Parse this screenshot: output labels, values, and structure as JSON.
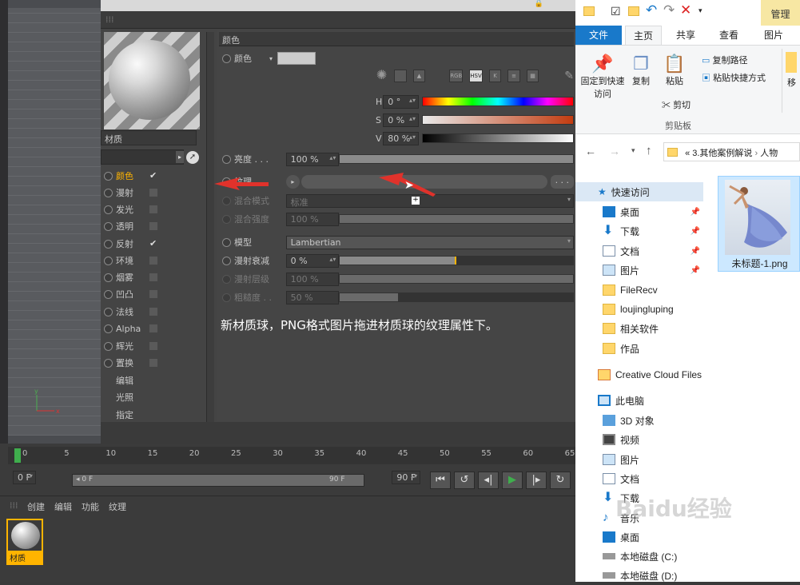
{
  "material_editor": {
    "material_name": "材质",
    "channels": [
      {
        "label": "颜色",
        "checked": true,
        "active": true
      },
      {
        "label": "漫射",
        "checked": false
      },
      {
        "label": "发光",
        "checked": false
      },
      {
        "label": "透明",
        "checked": false
      },
      {
        "label": "反射",
        "checked": true
      },
      {
        "label": "环境",
        "checked": false
      },
      {
        "label": "烟雾",
        "checked": false
      },
      {
        "label": "凹凸",
        "checked": false
      },
      {
        "label": "法线",
        "checked": false
      },
      {
        "label": "Alpha",
        "checked": false
      },
      {
        "label": "辉光",
        "checked": false
      },
      {
        "label": "置换",
        "checked": false
      },
      {
        "label": "编辑"
      },
      {
        "label": "光照"
      },
      {
        "label": "指定"
      }
    ],
    "section_title": "颜色",
    "color_label": "颜色",
    "modes": [
      "RGB",
      "HSV",
      "K"
    ],
    "h_label": "H",
    "h_value": "0 °",
    "s_label": "S",
    "s_value": "0 %",
    "v_label": "V",
    "v_value": "80 %",
    "brightness_label": "亮度 . . .",
    "brightness_value": "100 %",
    "texture_label": "纹理 . . .",
    "texture_more": ". . .",
    "blend_mode_label": "混合模式",
    "blend_mode_value": "标准",
    "blend_strength_label": "混合强度",
    "blend_strength_value": "100 %",
    "model_label": "模型",
    "model_value": "Lambertian",
    "diffuse_falloff_label": "漫射衰减",
    "diffuse_falloff_value": "0 %",
    "diffuse_level_label": "漫射层级",
    "diffuse_level_value": "100 %",
    "roughness_label": "粗糙度 . .",
    "roughness_value": "50 %",
    "caption": "新材质球，PNG格式图片拖进材质球的纹理属性下。"
  },
  "timeline": {
    "ticks": [
      "0",
      "5",
      "10",
      "15",
      "20",
      "25",
      "30",
      "35",
      "40",
      "45",
      "50",
      "55",
      "60",
      "65"
    ],
    "current_frame": "0 F",
    "range_start": "0 F",
    "range_end": "90 F",
    "end_frame": "90 F"
  },
  "material_manager": {
    "menu": [
      "创建",
      "编辑",
      "功能",
      "纹理"
    ],
    "material_label": "材质"
  },
  "explorer": {
    "manage_tab": "管理",
    "tabs": [
      "文件",
      "主页",
      "共享",
      "查看",
      "图片工具"
    ],
    "ribbon": {
      "pin_label": "固定到快速访问",
      "copy_label": "复制",
      "paste_label": "粘贴",
      "copy_path": "复制路径",
      "paste_shortcut": "粘贴快捷方式",
      "cut": "剪切",
      "clipboard_group": "剪贴板",
      "move_label": "移"
    },
    "address": [
      "3.其他案例解说",
      "人物"
    ],
    "address_prefix": "«",
    "nav": [
      {
        "label": "快速访问",
        "icon": "star-icon",
        "selected": true
      },
      {
        "label": "桌面",
        "icon": "desktop-icon",
        "pinned": true
      },
      {
        "label": "下载",
        "icon": "download-icon",
        "pinned": true
      },
      {
        "label": "文档",
        "icon": "document-icon",
        "pinned": true
      },
      {
        "label": "图片",
        "icon": "picture-icon",
        "pinned": true
      },
      {
        "label": "FileRecv",
        "icon": "folder-icon"
      },
      {
        "label": "loujingluping",
        "icon": "folder-icon"
      },
      {
        "label": "相关软件",
        "icon": "folder-icon"
      },
      {
        "label": "作品",
        "icon": "folder-icon"
      },
      {
        "label": "Creative Cloud Files",
        "icon": "creative-cloud-icon"
      },
      {
        "label": "此电脑",
        "icon": "computer-icon"
      },
      {
        "label": "3D 对象",
        "icon": "3d-objects-icon"
      },
      {
        "label": "视频",
        "icon": "video-icon"
      },
      {
        "label": "图片",
        "icon": "picture-icon"
      },
      {
        "label": "文档",
        "icon": "document-icon"
      },
      {
        "label": "下载",
        "icon": "download-icon"
      },
      {
        "label": "音乐",
        "icon": "music-icon"
      },
      {
        "label": "桌面",
        "icon": "desktop-icon"
      },
      {
        "label": "本地磁盘 (C:)",
        "icon": "drive-icon"
      },
      {
        "label": "本地磁盘 (D:)",
        "icon": "drive-icon"
      }
    ],
    "file_name": "未标题-1.png"
  },
  "watermark": "Baidu经验",
  "colors": {
    "accent": "#ffb400",
    "explorer_blue": "#1979ca",
    "arrow_red": "#e0322b"
  }
}
